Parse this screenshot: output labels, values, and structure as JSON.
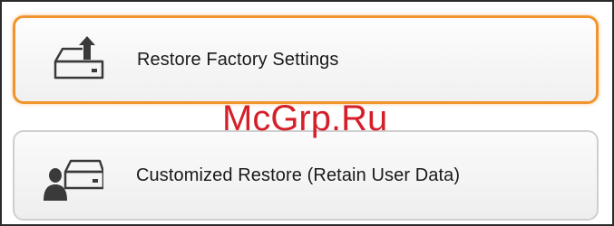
{
  "options": [
    {
      "label": "Restore Factory Settings",
      "icon": "drive-upload-icon",
      "selected": true
    },
    {
      "label": "Customized Restore (Retain User Data)",
      "icon": "user-drive-icon",
      "selected": false
    }
  ],
  "watermark": {
    "text": "McGrp.Ru"
  },
  "colors": {
    "selected_border": "#f0952e",
    "watermark": "#d5202a"
  }
}
